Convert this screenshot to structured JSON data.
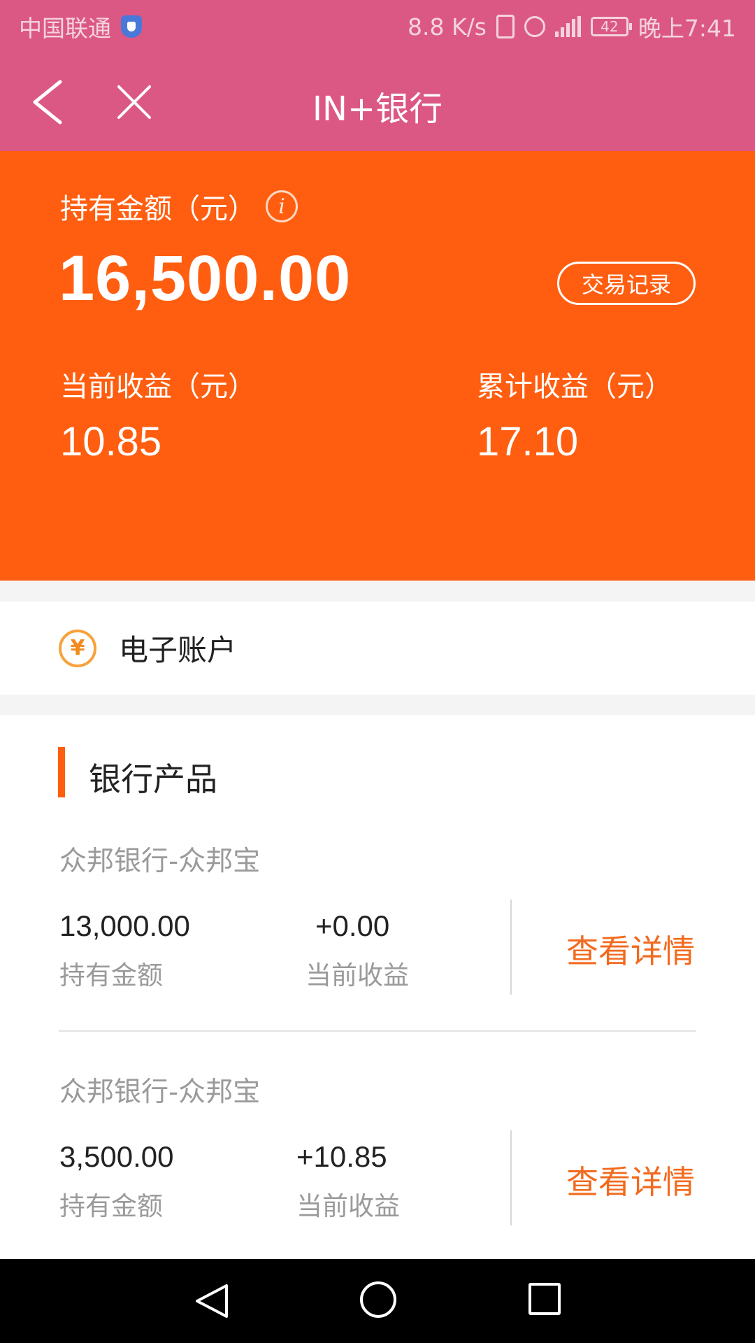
{
  "status_bar": {
    "carrier": "中国联通",
    "net_speed": "8.8 K/s",
    "battery": "42",
    "time": "晚上7:41",
    "icons": [
      "shield-icon",
      "vibrate-icon",
      "alarm-icon",
      "signal-icon",
      "battery-icon"
    ]
  },
  "header": {
    "title": "IN+银行",
    "back_icon": "chevron-left-icon",
    "close_icon": "close-icon"
  },
  "summary": {
    "hold_label": "持有金额（元）",
    "info_glyph": "i",
    "hold_amount": "16,500.00",
    "records_button": "交易记录",
    "current_income_label": "当前收益（元）",
    "current_income_value": "10.85",
    "total_income_label": "累计收益（元）",
    "total_income_value": "17.10"
  },
  "eaccount": {
    "icon_glyph": "¥",
    "label": "电子账户"
  },
  "products": {
    "section_title": "银行产品",
    "items": [
      {
        "name": "众邦银行-众邦宝",
        "amount": "13,000.00",
        "amount_label": "持有金额",
        "income": "+0.00",
        "income_label": "当前收益",
        "detail_label": "查看详情"
      },
      {
        "name": "众邦银行-众邦宝",
        "amount": "3,500.00",
        "amount_label": "持有金额",
        "income": "+10.85",
        "income_label": "当前收益",
        "detail_label": "查看详情"
      }
    ]
  },
  "colors": {
    "header_bg": "#dc5884",
    "summary_bg": "#ff5e10",
    "accent": "#f26a1e",
    "muted_text": "#9a9a9a"
  },
  "nav_bar": {
    "icons": [
      "nav-back-icon",
      "nav-home-icon",
      "nav-recent-icon"
    ]
  }
}
